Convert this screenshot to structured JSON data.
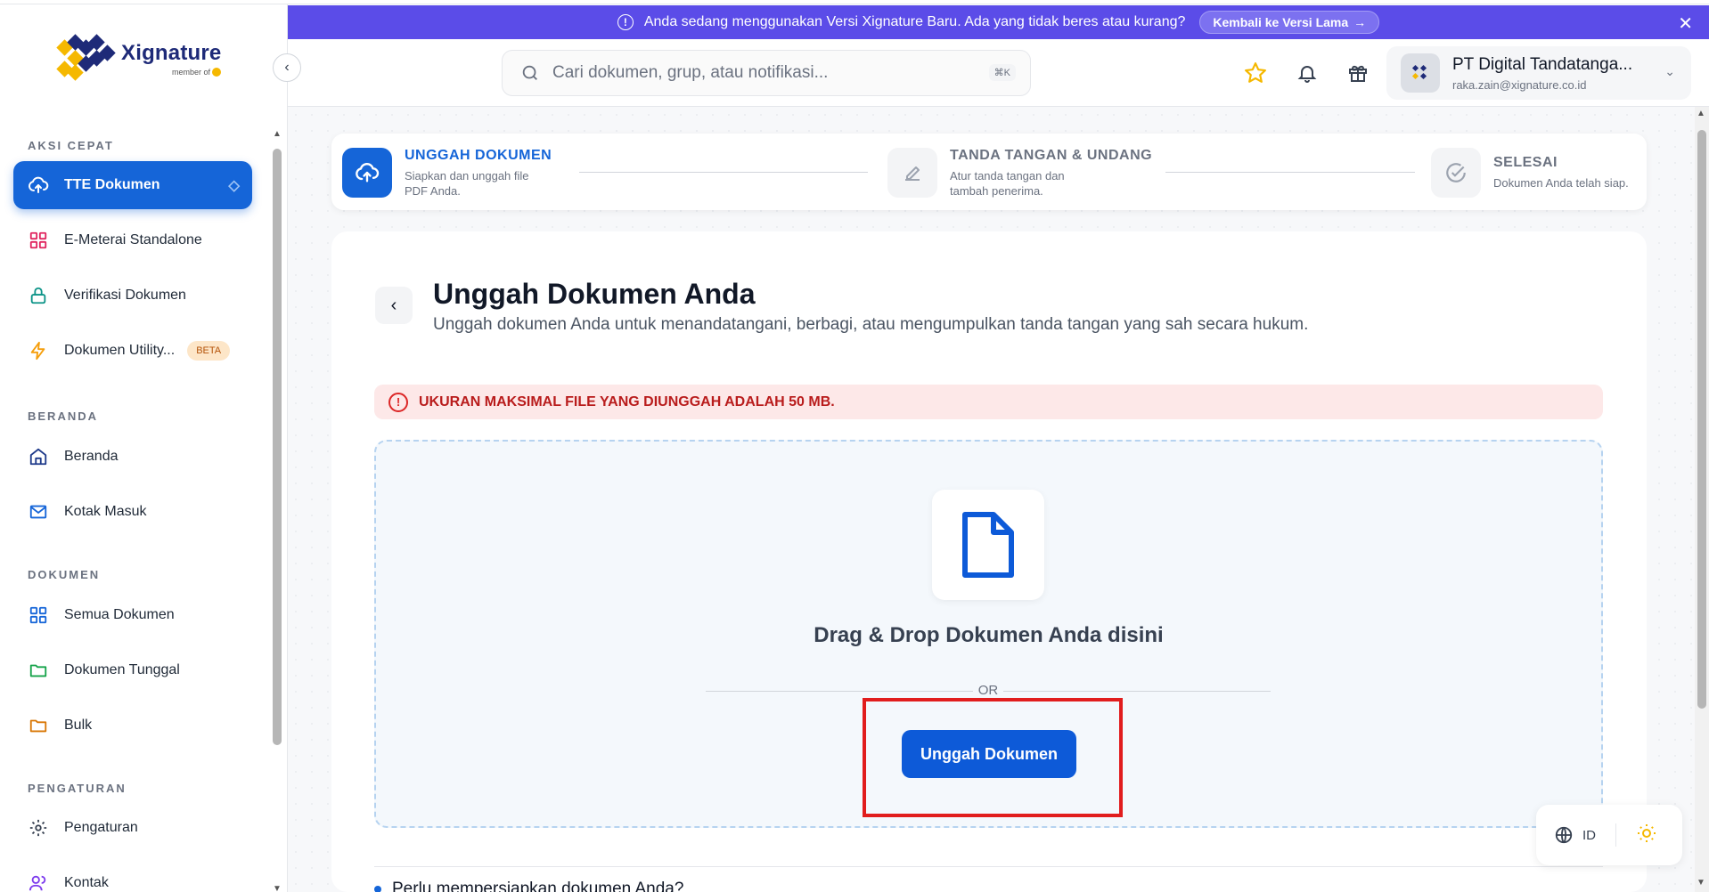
{
  "banner": {
    "message": "Anda sedang menggunakan Versi Xignature Baru.  Ada yang tidak beres atau kurang?",
    "button_label": "Kembali ke Versi Lama",
    "color": "#5b4ce8"
  },
  "logo": {
    "name": "Xignature",
    "tagline": "member of"
  },
  "sidebar": {
    "sections": {
      "aksi_cepat": "AKSI CEPAT",
      "beranda": "BERANDA",
      "dokumen": "DOKUMEN",
      "pengaturan": "PENGATURAN"
    },
    "items": [
      {
        "label": "TTE Dokumen",
        "icon": "upload-cloud-icon",
        "active": true
      },
      {
        "label": "E-Meterai Standalone",
        "icon": "grid-icon"
      },
      {
        "label": "Verifikasi Dokumen",
        "icon": "lock-icon"
      },
      {
        "label": "Dokumen Utility...",
        "icon": "bolt-icon",
        "badge": "BETA"
      },
      {
        "label": "Beranda",
        "icon": "home-icon"
      },
      {
        "label": "Kotak Masuk",
        "icon": "mail-icon"
      },
      {
        "label": "Semua Dokumen",
        "icon": "grid-icon"
      },
      {
        "label": "Dokumen Tunggal",
        "icon": "folder-icon"
      },
      {
        "label": "Bulk",
        "icon": "folder-icon"
      },
      {
        "label": "Pengaturan",
        "icon": "gear-icon"
      },
      {
        "label": "Kontak",
        "icon": "users-icon"
      }
    ],
    "accent": "#1565d8"
  },
  "header": {
    "search_placeholder": "Cari dokumen, grup, atau notifikasi...",
    "search_shortcut": "⌘K",
    "profile_name": "PT Digital Tandatanga...",
    "profile_email": "raka.zain@xignature.co.id"
  },
  "stepper": {
    "steps": [
      {
        "title": "UNGGAH DOKUMEN",
        "desc_1": "Siapkan dan unggah file",
        "desc_2": "PDF Anda.",
        "active": true
      },
      {
        "title": "TANDA TANGAN & UNDANG",
        "desc_1": "Atur tanda tangan dan",
        "desc_2": "tambah penerima.",
        "active": false
      },
      {
        "title": "SELESAI",
        "desc_1": "Dokumen Anda telah siap.",
        "active": false
      }
    ]
  },
  "main": {
    "title": "Unggah Dokumen Anda",
    "subtitle": "Unggah dokumen Anda untuk menandatangani, berbagi, atau mengumpulkan tanda tangan yang sah secara hukum.",
    "alert": "UKURAN MAKSIMAL FILE YANG DIUNGGAH ADALAH 50 MB.",
    "dropzone_title": "Drag & Drop Dokumen Anda disini",
    "or_label": "OR",
    "upload_button": "Unggah Dokumen",
    "bottom_hint": "Perlu mempersiapkan dokumen Anda?"
  },
  "footer_controls": {
    "language": "ID"
  }
}
